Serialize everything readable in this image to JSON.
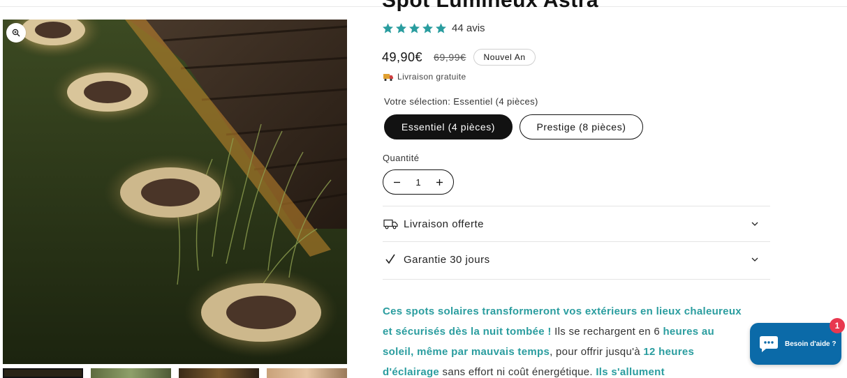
{
  "product": {
    "title": "Spot Lumineux Astra",
    "rating_count": "44 avis",
    "price": "49,90€",
    "compare_price": "69,99€",
    "badge": "Nouvel An",
    "shipping": "Livraison gratuite"
  },
  "variant": {
    "label": "Votre sélection: Essentiel (4 pièces)",
    "options": [
      "Essentiel (4 pièces)",
      "Prestige (8 pièces)"
    ],
    "selected_index": 0
  },
  "quantity": {
    "label": "Quantité",
    "value": "1"
  },
  "accordions": [
    {
      "label": "Livraison offerte",
      "icon": "truck-icon"
    },
    {
      "label": "Garantie 30 jours",
      "icon": "checkmark-icon"
    }
  ],
  "description": {
    "parts": [
      {
        "text": "Ces spots solaires transformeront vos extérieurs en lieux chaleureux et sécurisés dès la nuit tombée !",
        "highlight": true
      },
      {
        "text": " Ils se rechargent en 6 ",
        "highlight": false
      },
      {
        "text": "heures au soleil, même par mauvais temps",
        "highlight": true
      },
      {
        "text": ", pour offrir jusqu'à ",
        "highlight": false
      },
      {
        "text": "12 heures d'éclairage",
        "highlight": true
      },
      {
        "text": " sans effort ni coût énergétique. ",
        "highlight": false
      },
      {
        "text": "Ils s'allument",
        "highlight": true
      }
    ]
  },
  "chat": {
    "label": "Besoin d'aide ?",
    "badge": "1"
  },
  "colors": {
    "accent_teal": "#2a9d9f",
    "star": "#2a9d9f",
    "chat_bg": "#0b6aa8",
    "badge_red": "#e8384f",
    "primary": "#121212"
  }
}
